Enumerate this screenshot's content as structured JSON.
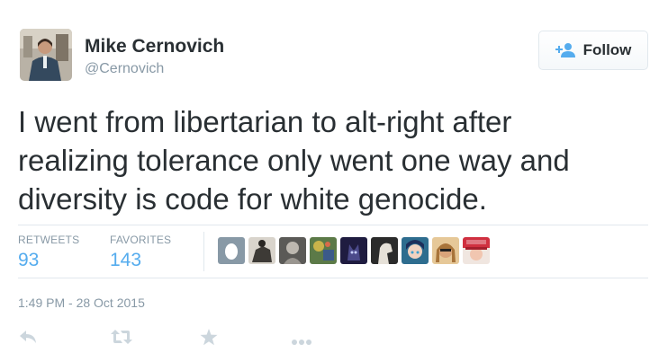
{
  "author": {
    "name": "Mike Cernovich",
    "handle": "@Cernovich"
  },
  "follow_button": {
    "label": "Follow",
    "icon": "follow-person-plus-icon"
  },
  "tweet": {
    "lines": [
      "I went from libertarian to alt-right after",
      "realizing tolerance only went one way and",
      "diversity is code for white genocide."
    ]
  },
  "stats": {
    "retweets_label": "RETWEETS",
    "retweets_count": "93",
    "favorites_label": "FAVORITES",
    "favorites_count": "143"
  },
  "favoriter_avatars": [
    {
      "icon": "default-egg-avatar",
      "color": "#8899a6"
    },
    {
      "icon": "horse-rider-avatar",
      "color": "#3d3a36"
    },
    {
      "icon": "statue-avatar",
      "color": "#9a9690"
    },
    {
      "icon": "colorful-artwork-avatar",
      "color": "#5c7a48"
    },
    {
      "icon": "wolf-avatar",
      "color": "#2d2a5a"
    },
    {
      "icon": "white-horse-avatar",
      "color": "#cfc8be"
    },
    {
      "icon": "anime-girl-avatar",
      "color": "#2e6d8f"
    },
    {
      "icon": "woman-sunglasses-avatar",
      "color": "#c9a06a"
    },
    {
      "icon": "red-hat-avatar",
      "color": "#d03040"
    }
  ],
  "timestamp": "1:49 PM - 28 Oct 2015",
  "actions": [
    {
      "icon": "reply-icon"
    },
    {
      "icon": "retweet-icon"
    },
    {
      "icon": "favorite-star-icon"
    },
    {
      "icon": "more-icon"
    }
  ],
  "colors": {
    "accent": "#55acee",
    "muted_text": "#8899a6",
    "body_text": "#292f33",
    "divider": "#e1e8ed",
    "action_icon": "#ccd6dd"
  }
}
